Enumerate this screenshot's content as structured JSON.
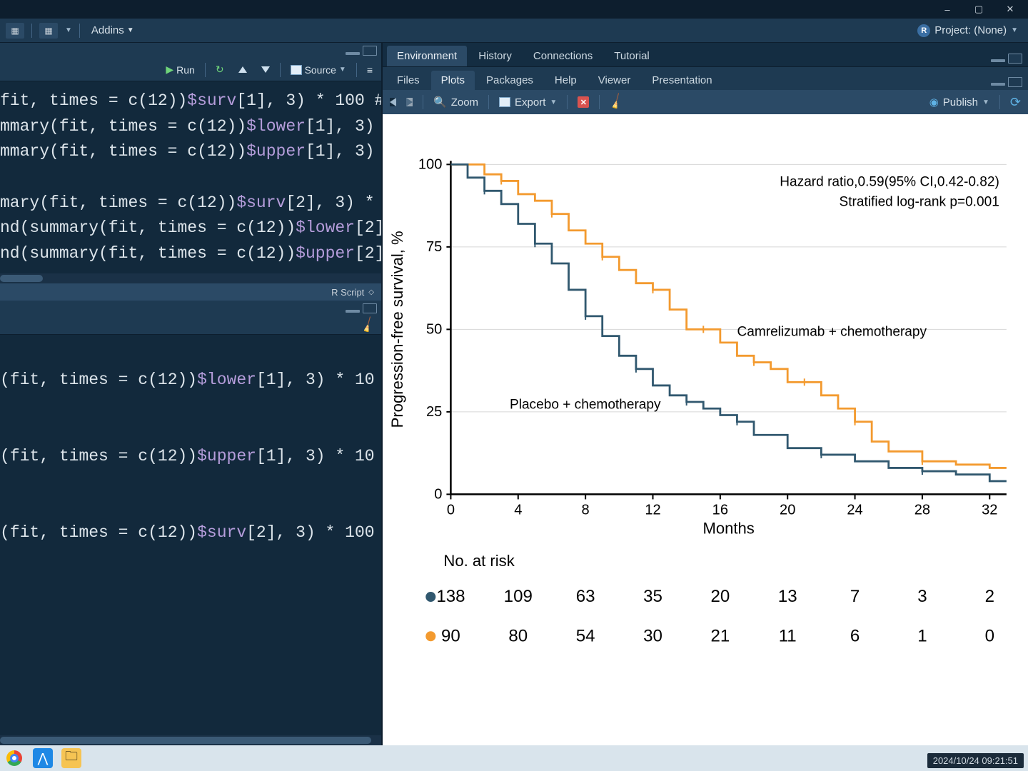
{
  "window": {
    "minimize": "–",
    "maximize": "▢",
    "close": "✕"
  },
  "toolbar": {
    "addins": "Addins",
    "project_label": "Project: (None)"
  },
  "source": {
    "run": "Run",
    "source_btn": "Source",
    "status": "R Script",
    "lines": [
      "fit, times = c(12))$surv[1], 3) * 100 #",
      "mmary(fit, times = c(12))$lower[1], 3)",
      "mmary(fit, times = c(12))$upper[1], 3)",
      "",
      "mary(fit, times = c(12))$surv[2], 3) *",
      "nd(summary(fit, times = c(12))$lower[2]",
      "nd(summary(fit, times = c(12))$upper[2]"
    ]
  },
  "console": {
    "lines": [
      "",
      "(fit, times = c(12))$lower[1], 3) * 10",
      "",
      "",
      "(fit, times = c(12))$upper[1], 3) * 10",
      "",
      "",
      "(fit, times = c(12))$surv[2], 3) * 100",
      ""
    ]
  },
  "right": {
    "tabs": [
      "Environment",
      "History",
      "Connections",
      "Tutorial"
    ],
    "subtabs": [
      "Files",
      "Plots",
      "Packages",
      "Help",
      "Viewer",
      "Presentation"
    ],
    "active_tab": "Environment",
    "active_subtab": "Plots",
    "pt": {
      "zoom": "Zoom",
      "export": "Export",
      "publish": "Publish"
    }
  },
  "taskbar": {
    "timestamp": "2024/10/24 09:21:51"
  },
  "chart_data": {
    "type": "line",
    "title": "",
    "xlabel": "Months",
    "ylabel": "Progression-free survival, %",
    "xlim": [
      0,
      33
    ],
    "ylim": [
      0,
      100
    ],
    "xticks": [
      0,
      4,
      8,
      12,
      16,
      20,
      24,
      28,
      32
    ],
    "yticks": [
      0,
      25,
      50,
      75,
      100
    ],
    "annotations": [
      "Hazard ratio,0.59(95% CI,0.42-0.82)",
      "Stratified log-rank p=0.001"
    ],
    "label_camre": "Camrelizumab + chemotherapy",
    "label_placebo": "Placebo + chemotherapy",
    "colors": {
      "camre": "#f39a2f",
      "placebo": "#31586f"
    },
    "series": [
      {
        "name": "Camrelizumab + chemotherapy",
        "x": [
          0,
          2,
          3,
          4,
          5,
          6,
          7,
          8,
          9,
          10,
          11,
          12,
          13,
          14,
          15,
          16,
          17,
          18,
          19,
          20,
          21,
          22,
          23,
          24,
          25,
          26,
          28,
          30,
          32,
          33
        ],
        "y": [
          100,
          97,
          95,
          91,
          89,
          85,
          80,
          76,
          72,
          68,
          64,
          62,
          56,
          50,
          50,
          46,
          42,
          40,
          38,
          34,
          34,
          30,
          26,
          22,
          16,
          13,
          10,
          9,
          8,
          8
        ]
      },
      {
        "name": "Placebo + chemotherapy",
        "x": [
          0,
          1,
          2,
          3,
          4,
          5,
          6,
          7,
          8,
          9,
          10,
          11,
          12,
          13,
          14,
          15,
          16,
          17,
          18,
          20,
          22,
          24,
          26,
          28,
          30,
          32,
          33
        ],
        "y": [
          100,
          96,
          92,
          88,
          82,
          76,
          70,
          62,
          54,
          48,
          42,
          38,
          33,
          30,
          28,
          26,
          24,
          22,
          18,
          14,
          12,
          10,
          8,
          7,
          6,
          4,
          4
        ]
      }
    ],
    "risk_table": {
      "title": "No. at risk",
      "months": [
        0,
        4,
        8,
        12,
        16,
        20,
        24,
        28,
        32
      ],
      "rows": [
        {
          "color": "#31586f",
          "values": [
            138,
            109,
            63,
            35,
            20,
            13,
            7,
            3,
            2
          ]
        },
        {
          "color": "#f39a2f",
          "values": [
            90,
            80,
            54,
            30,
            21,
            11,
            6,
            1,
            0
          ]
        }
      ]
    }
  }
}
